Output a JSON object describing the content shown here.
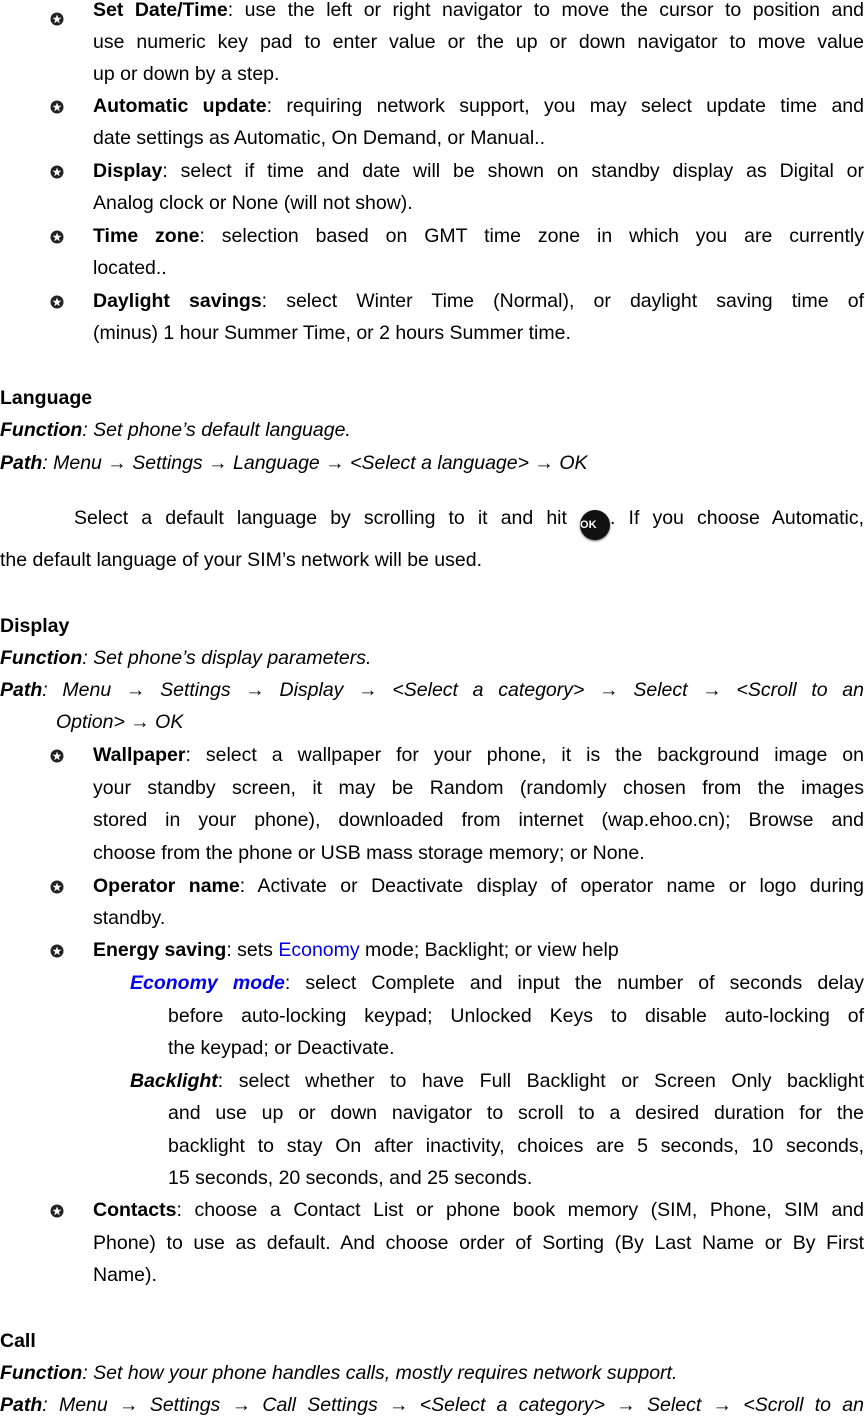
{
  "date_time_items": [
    {
      "term": "Set Date/Time",
      "lines": [
        ": use the left or right navigator to move the cursor to position and",
        "use numeric key pad to enter value or the up or down navigator to move value",
        "up or down by a step."
      ]
    },
    {
      "term": "Automatic update",
      "lines": [
        ": requiring network support, you may select update time and",
        "date settings as Automatic, On Demand, or Manual.."
      ]
    },
    {
      "term": "Display",
      "lines": [
        ": select if time and date will be shown on standby display as Digital or",
        "Analog clock or None (will not show)."
      ]
    },
    {
      "term": "Time zone",
      "lines": [
        ": selection based on GMT time zone in which you are currently",
        "located.."
      ]
    },
    {
      "term": "Daylight savings",
      "lines": [
        ": select Winter Time (Normal), or daylight saving time of",
        "(minus) 1 hour Summer Time, or 2 hours Summer time."
      ]
    }
  ],
  "language": {
    "heading": "Language",
    "function_label": "Function",
    "function_text": ": Set phone’s default language.",
    "path_label": "Path",
    "path_text": ": Menu → Settings → Language → <Select a language> → OK",
    "body_line1_a": "Select a default language by scrolling to it and hit",
    "ok_icon_label": "OK",
    "body_line1_b": ". If you choose Automatic,",
    "body_line2": "the default language of your SIM’s network will be used."
  },
  "display": {
    "heading": "Display",
    "function_label": "Function",
    "function_text": ": Set phone’s display parameters.",
    "path_label": "Path",
    "path_line1": ": Menu → Settings → Display → <Select a category> → Select → <Scroll to an",
    "path_line2": "Option> → OK",
    "items": [
      {
        "term": "Wallpaper",
        "lines": [
          ": select a wallpaper for your phone, it is the background image on",
          "your standby screen, it may be Random (randomly chosen from the images",
          "stored in your phone), downloaded from internet (wap.ehoo.cn); Browse and",
          "choose from the phone or USB mass storage memory; or None."
        ]
      },
      {
        "term": "Operator name",
        "lines": [
          ": Activate or Deactivate display of operator name or logo during",
          "standby."
        ]
      },
      {
        "term": "Energy saving",
        "pre": ": sets ",
        "link": "Economy",
        "post": " mode; Backlight; or view help"
      },
      {
        "term": "Contacts",
        "lines": [
          ": choose a Contact List or phone book memory (SIM, Phone, SIM and",
          "Phone) to use as default. And choose order of Sorting (By Last Name or By First",
          "Name)."
        ]
      }
    ],
    "sub_items": [
      {
        "term": "Economy mode",
        "lines": [
          ": select Complete and input the number of seconds delay",
          "before auto-locking keypad; Unlocked Keys to disable auto-locking of",
          "the keypad; or Deactivate."
        ]
      },
      {
        "term": "Backlight",
        "lines": [
          ": select whether to have Full Backlight or Screen Only backlight",
          "and use up or down navigator to scroll to a desired duration for the",
          "backlight to stay On after inactivity, choices are 5 seconds, 10 seconds,",
          "15 seconds, 20 seconds, and 25 seconds."
        ]
      }
    ]
  },
  "call": {
    "heading": "Call",
    "function_label": "Function",
    "function_text": ": Set how your phone handles calls, mostly requires network support.",
    "path_label": "Path",
    "path_line1": ": Menu → Settings → Call Settings → <Select a category> → Select → <Scroll to an"
  },
  "colors": {
    "link_blue": "#0000ee",
    "text": "#000000"
  }
}
